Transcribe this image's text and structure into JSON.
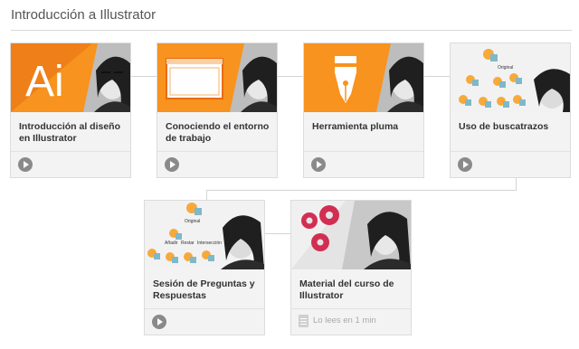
{
  "page": {
    "title": "Introducción a Illustrator"
  },
  "cards": [
    {
      "title": "Introducción al diseño en Illustrator",
      "icon": "ai-logo-icon",
      "footer": "play"
    },
    {
      "title": "Conociendo el entorno de trabajo",
      "icon": "window-icon",
      "footer": "play"
    },
    {
      "title": "Herramienta pluma",
      "icon": "pen-nib-icon",
      "footer": "play"
    },
    {
      "title": "Uso de buscatrazos",
      "icon": "pathfinder-diagram-icon",
      "footer": "play"
    },
    {
      "title": "Sesión de Preguntas y Respuestas",
      "icon": "pathfinder-diagram-icon",
      "footer": "play"
    },
    {
      "title": "Material del curso de Illustrator",
      "icon": "gears-icon",
      "footer": "doc",
      "read_time": "Lo lees en 1 min"
    }
  ],
  "diagram_labels": {
    "original": "Original",
    "add": "Añadir",
    "subtract": "Restar",
    "intersect": "Intersección"
  },
  "thumb_text": {
    "ai_logo": "Ai"
  },
  "colors": {
    "orange": "#f7931e",
    "orange_dark": "#e86b12",
    "red_gear": "#d22e52",
    "blue_shape": "#7fb8c8",
    "card_bg": "#f3f3f3"
  }
}
